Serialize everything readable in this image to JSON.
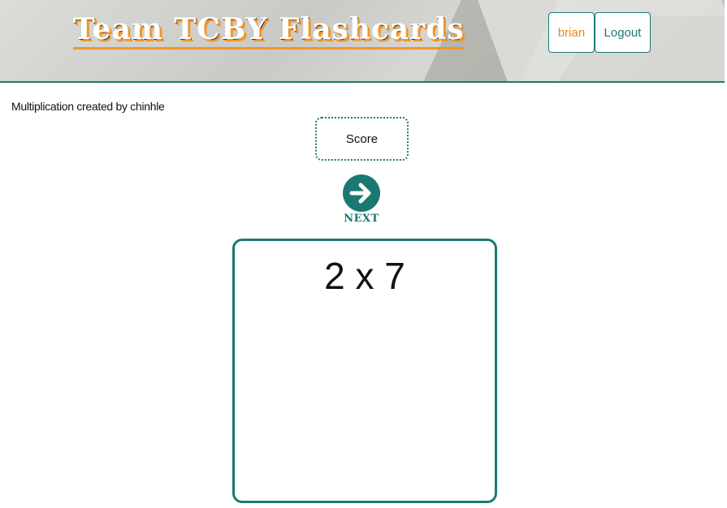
{
  "header": {
    "title": "Team TCBY Flashcards",
    "user_label": "brian",
    "logout_label": "Logout"
  },
  "deck": {
    "credit": "Multiplication created by chinhle"
  },
  "score": {
    "label": "Score"
  },
  "next": {
    "label": "NEXT",
    "icon": "arrow-right-circle-icon"
  },
  "card": {
    "question": "2 x 7"
  },
  "colors": {
    "accent": "#1a7a72",
    "orange": "#f0962a",
    "user_text": "#e88a1a"
  }
}
